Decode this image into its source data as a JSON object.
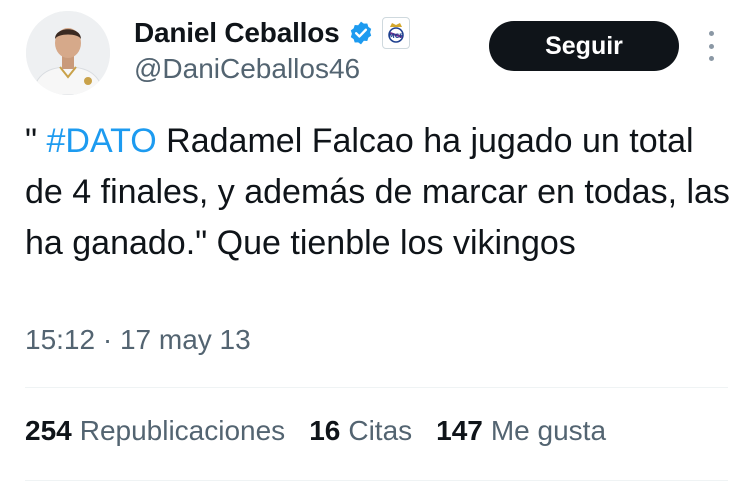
{
  "author": {
    "display_name": "Daniel Ceballos",
    "handle": "@DaniCeballos46",
    "verified_color": "#1d9bf0",
    "affiliation_icon": "real-madrid-crest-icon"
  },
  "follow_label": "Seguir",
  "tweet": {
    "prefix": "\" ",
    "hashtag": "#DATO",
    "body": " Radamel Falcao ha jugado un total de 4 finales, y además de marcar en todas, las ha ganado.\" Que tienble los vikingos",
    "timestamp": "15:12 · 17 may 13"
  },
  "stats": {
    "reposts_count": "254",
    "reposts_label": "Republicaciones",
    "quotes_count": "16",
    "quotes_label": "Citas",
    "likes_count": "147",
    "likes_label": "Me gusta"
  },
  "colors": {
    "accent": "#1d9bf0",
    "button_bg": "#0f1419",
    "secondary_text": "#536471"
  }
}
